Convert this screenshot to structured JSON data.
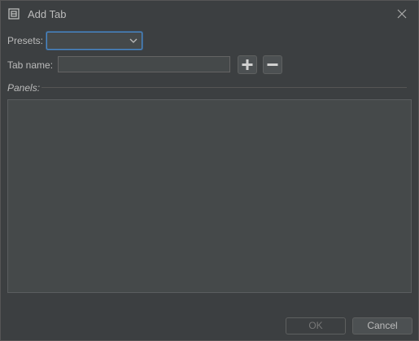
{
  "window": {
    "title": "Add Tab",
    "icon": "window-layout-icon",
    "close_icon": "close-icon"
  },
  "form": {
    "presets_label": "Presets:",
    "presets_value": "",
    "tab_name_label": "Tab name:",
    "tab_name_value": "",
    "add_icon": "plus-icon",
    "remove_icon": "minus-icon",
    "panels_label": "Panels:"
  },
  "buttons": {
    "ok_label": "OK",
    "ok_enabled": false,
    "cancel_label": "Cancel"
  },
  "colors": {
    "background": "#3c3f41",
    "field_background": "#45494a",
    "focus_border": "#4a88c7",
    "text": "#bbbbbb",
    "disabled_text": "#777777"
  }
}
